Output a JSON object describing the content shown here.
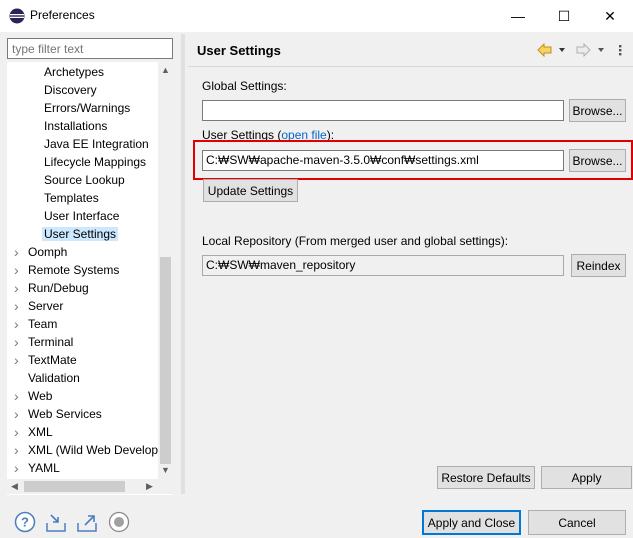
{
  "window": {
    "title": "Preferences",
    "minimize_glyph": "—",
    "maximize_glyph": "☐",
    "close_glyph": "✕"
  },
  "filter": {
    "placeholder": "type filter text"
  },
  "tree": {
    "items": [
      {
        "label": "Archetypes",
        "indent": 2,
        "expandable": false
      },
      {
        "label": "Discovery",
        "indent": 2,
        "expandable": false
      },
      {
        "label": "Errors/Warnings",
        "indent": 2,
        "expandable": false
      },
      {
        "label": "Installations",
        "indent": 2,
        "expandable": false
      },
      {
        "label": "Java EE Integration",
        "indent": 2,
        "expandable": false
      },
      {
        "label": "Lifecycle Mappings",
        "indent": 2,
        "expandable": false
      },
      {
        "label": "Source Lookup",
        "indent": 2,
        "expandable": false
      },
      {
        "label": "Templates",
        "indent": 2,
        "expandable": false
      },
      {
        "label": "User Interface",
        "indent": 2,
        "expandable": false
      },
      {
        "label": "User Settings",
        "indent": 2,
        "expandable": false,
        "selected": true
      },
      {
        "label": "Oomph",
        "indent": 1,
        "expandable": true
      },
      {
        "label": "Remote Systems",
        "indent": 1,
        "expandable": true
      },
      {
        "label": "Run/Debug",
        "indent": 1,
        "expandable": true
      },
      {
        "label": "Server",
        "indent": 1,
        "expandable": true
      },
      {
        "label": "Team",
        "indent": 1,
        "expandable": true
      },
      {
        "label": "Terminal",
        "indent": 1,
        "expandable": true
      },
      {
        "label": "TextMate",
        "indent": 1,
        "expandable": true
      },
      {
        "label": "Validation",
        "indent": 1,
        "expandable": false
      },
      {
        "label": "Web",
        "indent": 1,
        "expandable": true
      },
      {
        "label": "Web Services",
        "indent": 1,
        "expandable": true
      },
      {
        "label": "XML",
        "indent": 1,
        "expandable": true
      },
      {
        "label": "XML (Wild Web Develop",
        "indent": 1,
        "expandable": true
      },
      {
        "label": "YAML",
        "indent": 1,
        "expandable": true
      }
    ]
  },
  "page": {
    "title": "User Settings",
    "global_settings_label": "Global Settings:",
    "global_settings_value": "",
    "browse_label": "Browse...",
    "user_settings_label": "User Settings (",
    "open_file_link": "open file",
    "user_settings_label_end": "):",
    "user_settings_value": "C:₩SW₩apache-maven-3.5.0₩conf₩settings.xml",
    "update_settings_label": "Update Settings",
    "local_repo_label": "Local Repository (From merged user and global settings):",
    "local_repo_value": "C:₩SW₩maven_repository",
    "reindex_label": "Reindex",
    "restore_defaults_label": "Restore Defaults",
    "apply_label": "Apply"
  },
  "footer": {
    "apply_and_close_label": "Apply and Close",
    "cancel_label": "Cancel"
  },
  "colors": {
    "accent": "#0078d7",
    "highlight": "#e00000",
    "selection": "#cce8ff",
    "link": "#0066cc"
  }
}
